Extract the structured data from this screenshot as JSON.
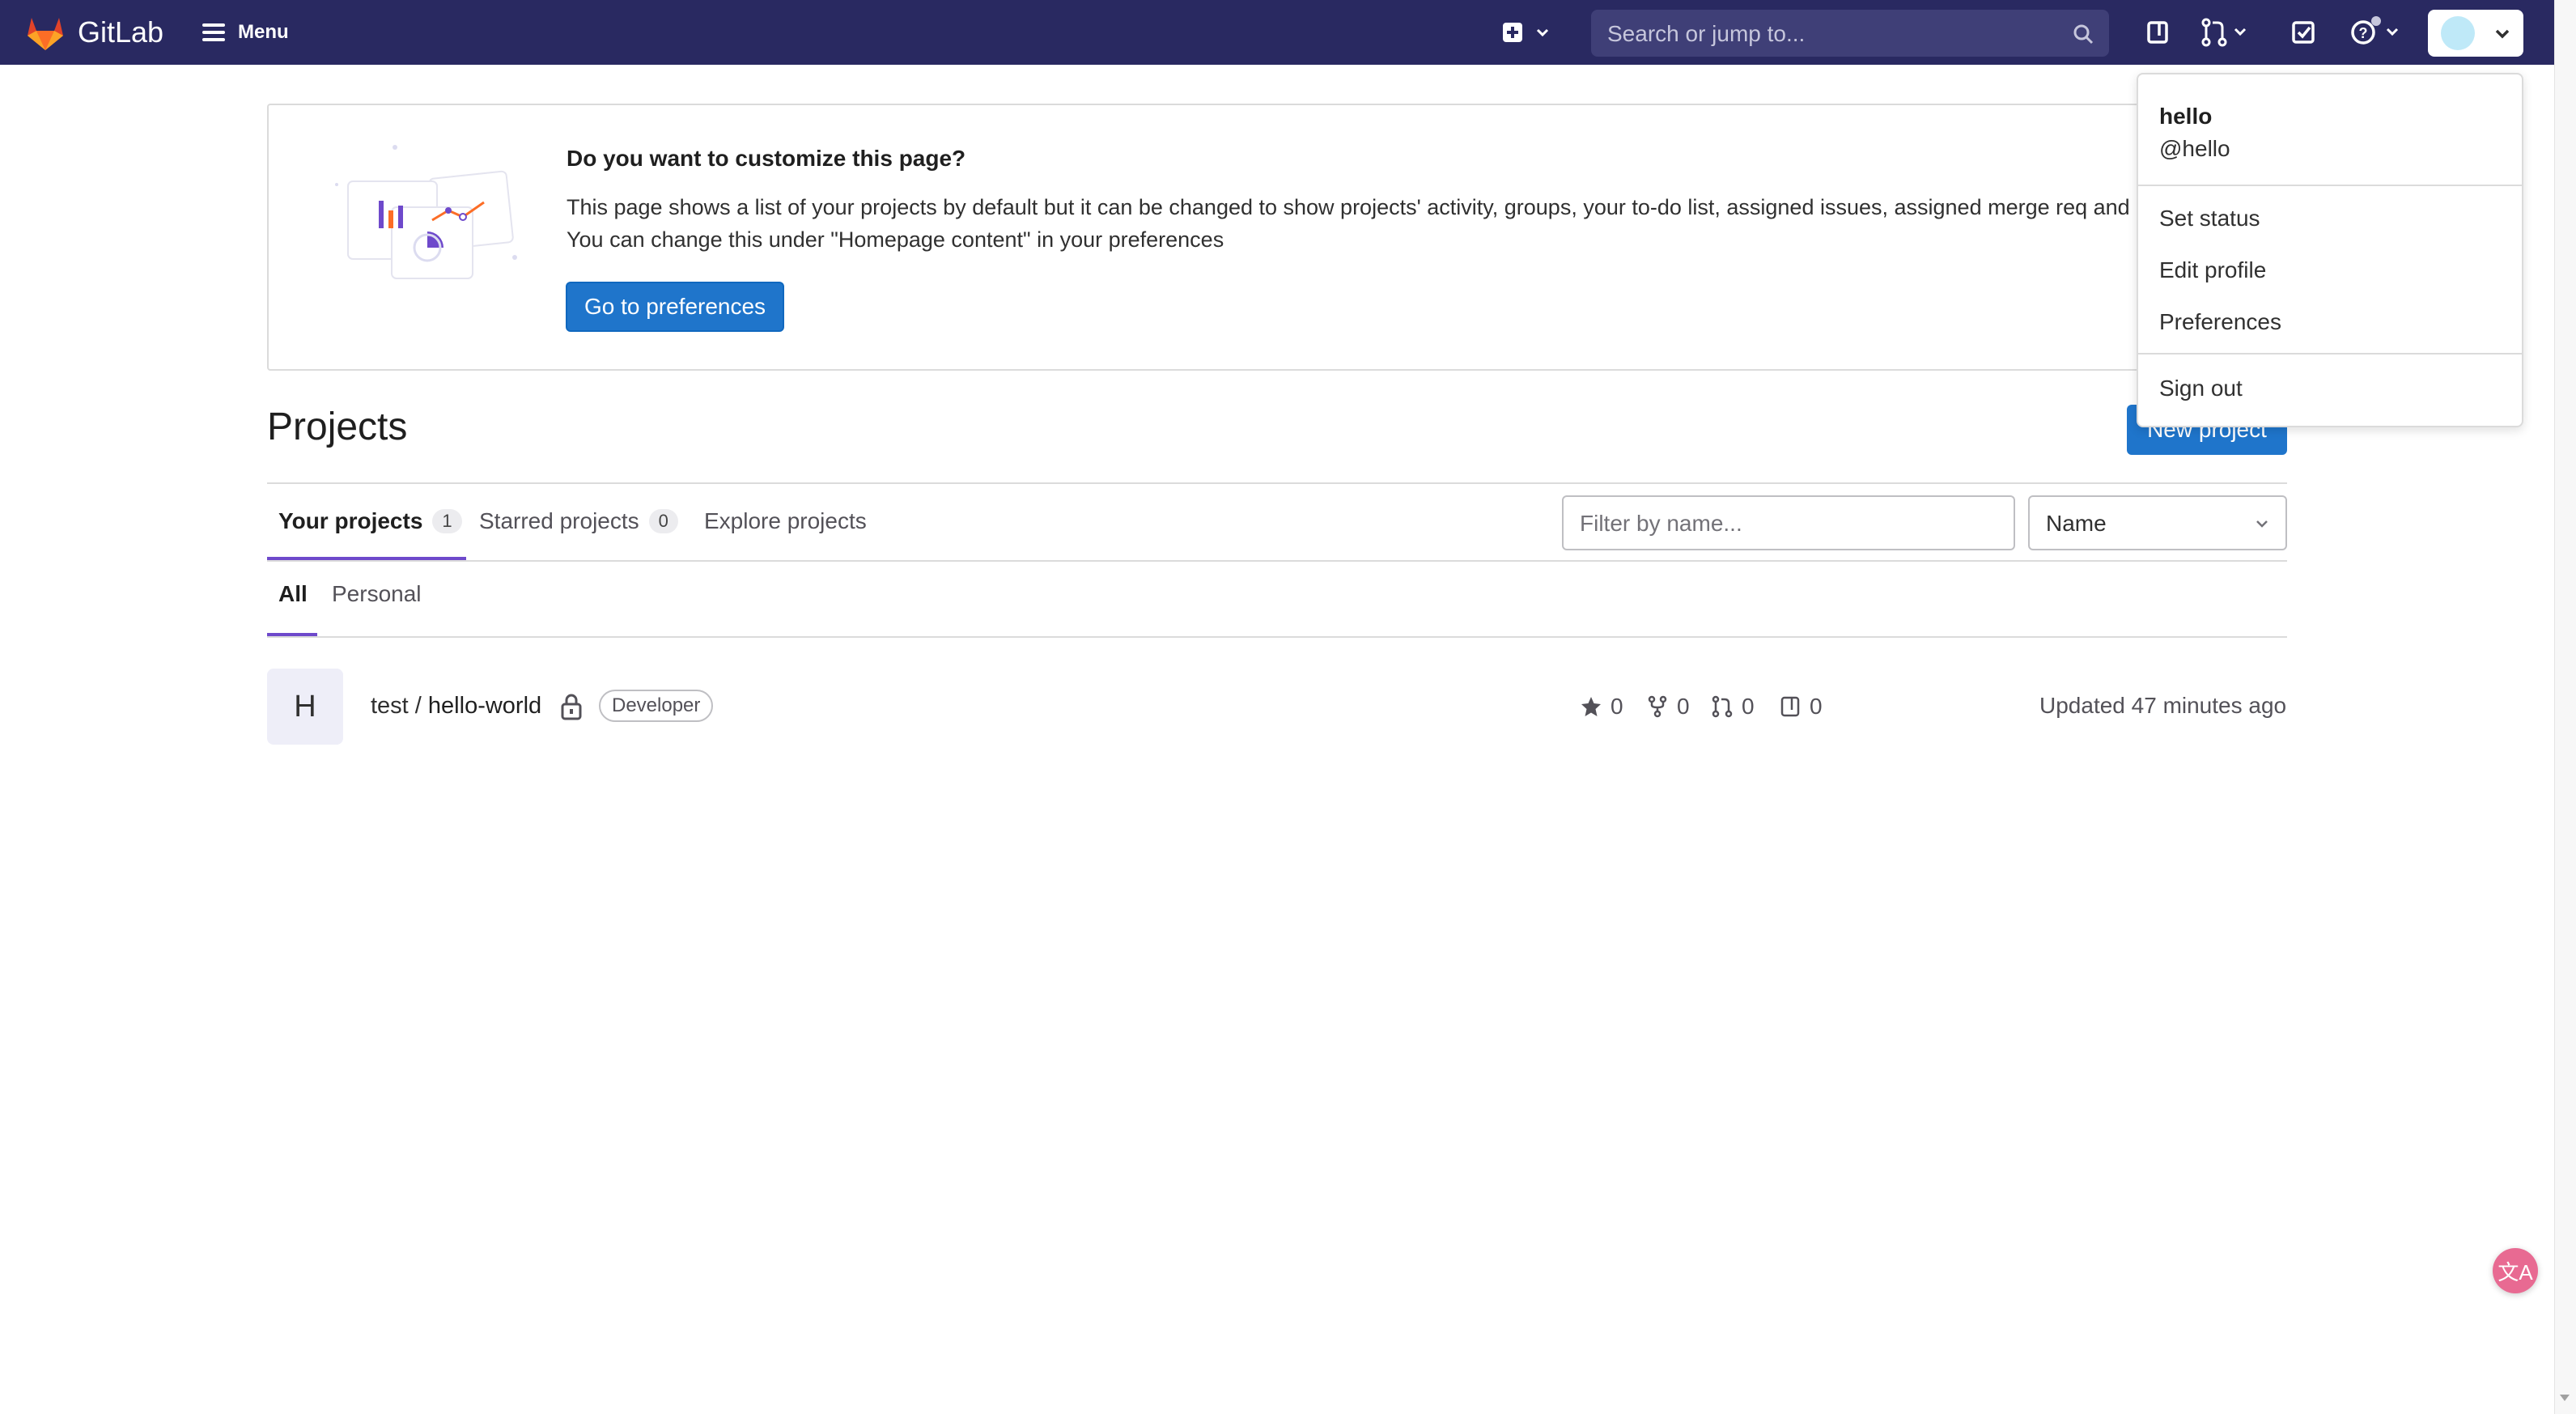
{
  "navbar": {
    "brand": "GitLab",
    "menu_label": "Menu",
    "search_placeholder": "Search or jump to..."
  },
  "banner": {
    "title": "Do you want to customize this page?",
    "text": "This page shows a list of your projects by default but it can be changed to show projects' activity, groups, your to-do list, assigned issues, assigned merge req and more. You can change this under \"Homepage content\" in your preferences",
    "button_label": "Go to preferences"
  },
  "projects": {
    "title": "Projects",
    "new_button": "New project",
    "tabs": [
      {
        "label": "Your projects",
        "count": "1"
      },
      {
        "label": "Starred projects",
        "count": "0"
      },
      {
        "label": "Explore projects"
      }
    ],
    "filter_placeholder": "Filter by name...",
    "sort_value": "Name",
    "subtabs": [
      "All",
      "Personal"
    ],
    "items": [
      {
        "avatar_letter": "H",
        "namespace": "test / ",
        "name": "hello-world",
        "role": "Developer",
        "stars": "0",
        "forks": "0",
        "merge_requests": "0",
        "issues": "0",
        "updated": "Updated 47 minutes ago"
      }
    ]
  },
  "user_menu": {
    "name": "hello",
    "handle": "@hello",
    "items": [
      "Set status",
      "Edit profile",
      "Preferences"
    ],
    "sign_out": "Sign out"
  },
  "widgets": {
    "translate_label": "文A"
  },
  "colors": {
    "navbar": "#292961",
    "primary": "#1f75cb",
    "tab_active": "#6e49cb",
    "avatar": "#bfe9f8"
  }
}
